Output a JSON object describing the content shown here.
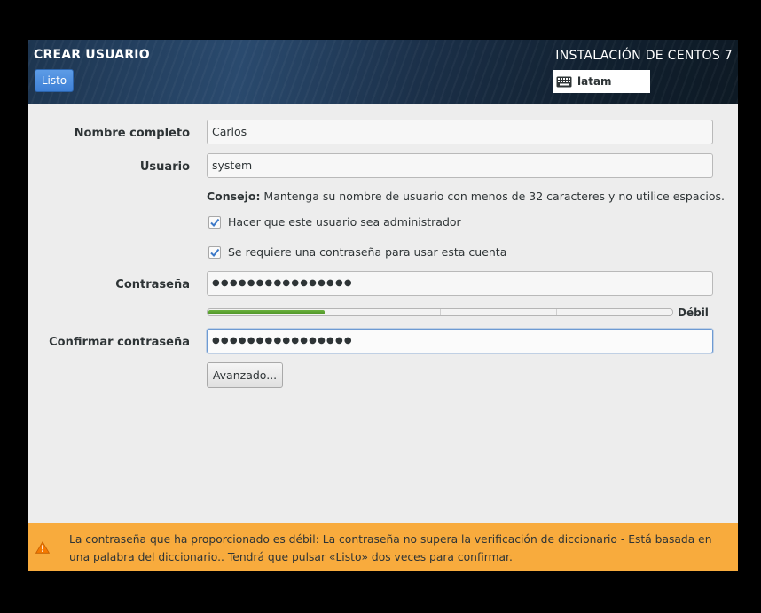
{
  "header": {
    "spoke_title": "CREAR USUARIO",
    "done_label": "Listo",
    "product_title": "INSTALACIÓN DE CENTOS 7",
    "keyboard_layout": "latam"
  },
  "form": {
    "fullname_label": "Nombre completo",
    "fullname_value": "Carlos",
    "username_label": "Usuario",
    "username_value": "system",
    "hint_bold": "Consejo:",
    "hint_text": " Mantenga su nombre de usuario con menos de 32 caracteres y no utilice espacios.",
    "admin_checkbox": {
      "label": "Hacer que este usuario sea administrador",
      "checked": true
    },
    "password_required_checkbox": {
      "label": "Se requiere una contraseña para usar esta cuenta",
      "checked": true
    },
    "password_label": "Contraseña",
    "password_value": "●●●●●●●●●●●●●●●●",
    "strength_label": "Débil",
    "strength_level": 0.25,
    "confirm_label": "Confirmar contraseña",
    "confirm_value": "●●●●●●●●●●●●●●●●",
    "advanced_label": "Avanzado..."
  },
  "warning": {
    "text": "La contraseña que ha proporcionado es débil: La contraseña no supera la verificación de diccionario - Está basada en una palabra del diccionario.. Tendrá que pulsar «Listo» dos veces para confirmar.",
    "color": "#f8ab3d"
  },
  "colors": {
    "accent": "#3e80d6",
    "strength_fill": "#4b8f24"
  },
  "icons": {
    "keyboard": "keyboard-icon",
    "check": "checkmark-icon",
    "warning": "warning-triangle-icon"
  }
}
